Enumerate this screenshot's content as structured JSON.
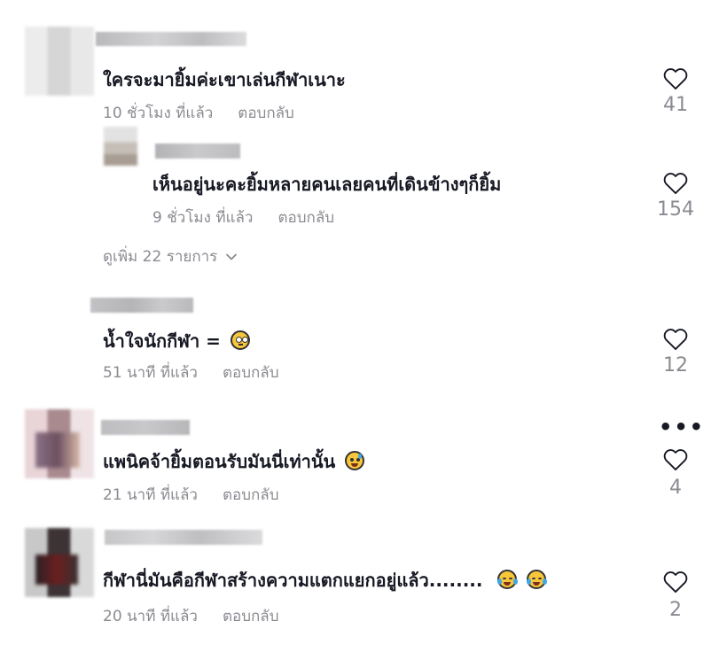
{
  "comments": [
    {
      "text": "ใครจะมายิ้มค่ะเขาเล่นกีฬาเนาะ",
      "time": "10 ชั่วโมง ที่แล้ว",
      "reply": "ตอบกลับ",
      "likes": "41"
    },
    {
      "text": "เห็นอยู่นะคะยิ้มหลายคนเลยคนที่เดินข้างๆก็ยิ้ม",
      "time": "9 ชั่วโมง ที่แล้ว",
      "reply": "ตอบกลับ",
      "likes": "154"
    },
    {
      "text": "น้ำใจนักกีฬา =",
      "time": "51 นาที ที่แล้ว",
      "reply": "ตอบกลับ",
      "likes": "12"
    },
    {
      "text": "แพนิคจ้ายิ้มตอนรับมันนี่เท่านั้น",
      "time": "21 นาที ที่แล้ว",
      "reply": "ตอบกลับ",
      "likes": "4"
    },
    {
      "text": "กีฬานี่มันคือกีฬาสร้างความแตกแยกอยู่แล้ว........",
      "time": "20 นาที ที่แล้ว",
      "reply": "ตอบกลับ",
      "likes": "2"
    }
  ],
  "view_more": "ดูเพิ่ม 22 รายการ",
  "more_options": "•••",
  "icons": {
    "heart": "heart-outline-icon",
    "chevron": "chevron-down-icon",
    "more": "more-icon",
    "emoji_flushed": "flushed-face-emoji",
    "emoji_sweat": "grinning-sweat-emoji",
    "emoji_joy": "tears-of-joy-emoji"
  },
  "colors": {
    "text": "#161823",
    "secondary": "#8a8b91",
    "background": "#ffffff"
  }
}
